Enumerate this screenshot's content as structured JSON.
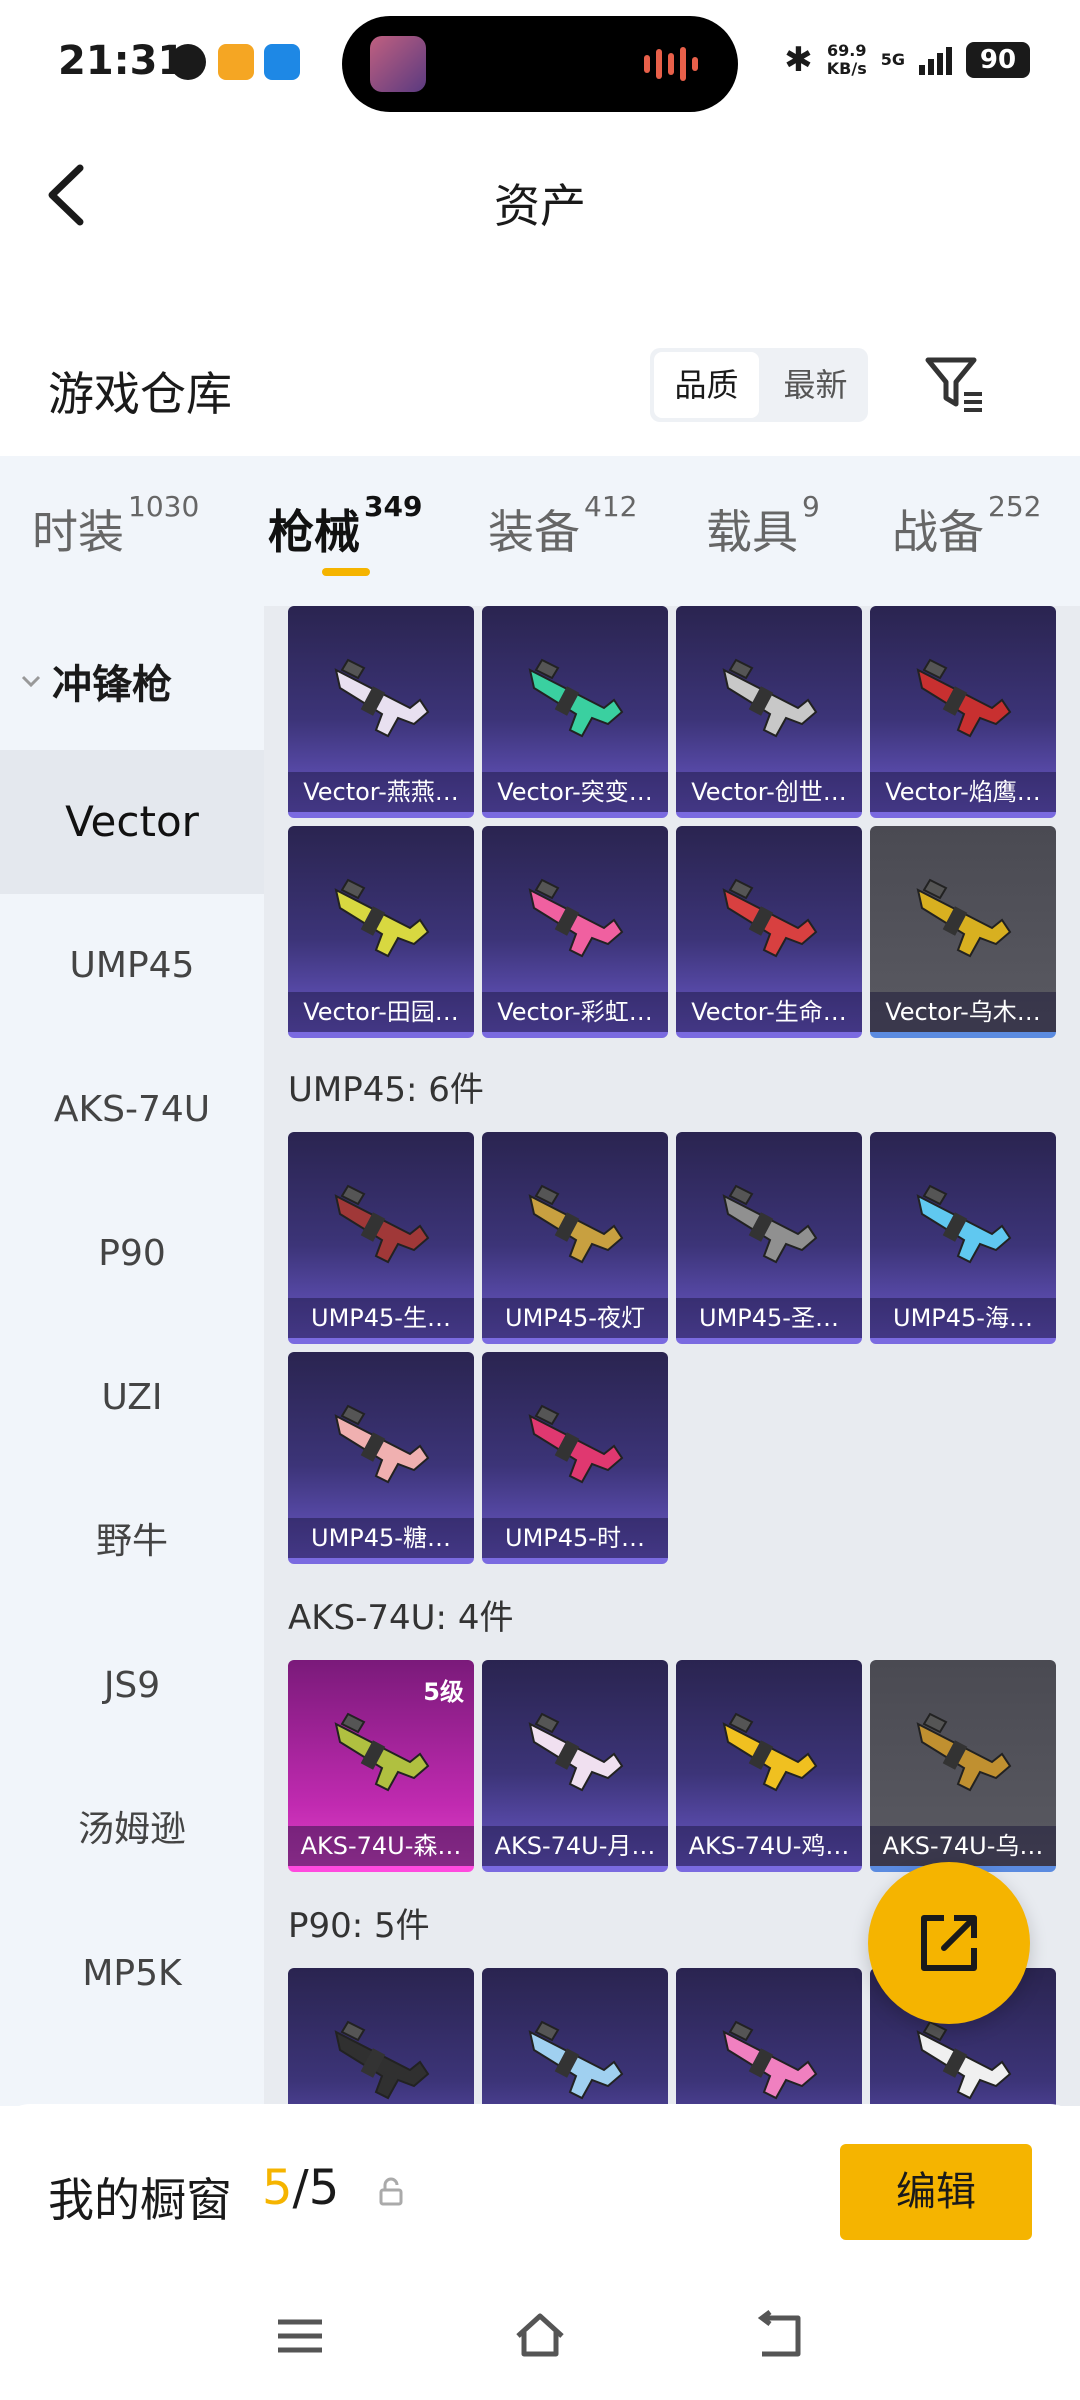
{
  "status_bar": {
    "time": "21:31",
    "speed_value": "69.9",
    "speed_unit": "KB/s",
    "network": "5G",
    "battery": "90"
  },
  "header": {
    "title": "资产"
  },
  "warehouse": {
    "title": "游戏仓库",
    "sort_options": [
      "品质",
      "最新"
    ],
    "active_sort": "品质"
  },
  "tabs": [
    {
      "label": "时装",
      "count": "1030"
    },
    {
      "label": "枪械",
      "count": "349"
    },
    {
      "label": "装备",
      "count": "412"
    },
    {
      "label": "载具",
      "count": "9"
    },
    {
      "label": "战备",
      "count": "252"
    }
  ],
  "sidebar": {
    "group": "冲锋枪",
    "items": [
      "Vector",
      "UMP45",
      "AKS-74U",
      "P90",
      "UZI",
      "野牛",
      "JS9",
      "汤姆逊",
      "MP5K"
    ],
    "active": "Vector"
  },
  "sections": [
    {
      "title": "",
      "items": [
        {
          "label": "Vector-燕燕…",
          "color": "#e8e0f0"
        },
        {
          "label": "Vector-突变…",
          "color": "#3ad0a0"
        },
        {
          "label": "Vector-创世…",
          "color": "#c8c8c8"
        },
        {
          "label": "Vector-焰鹰…",
          "color": "#c83030"
        },
        {
          "label": "Vector-田园…",
          "color": "#d8d840"
        },
        {
          "label": "Vector-彩虹…",
          "color": "#f060a0"
        },
        {
          "label": "Vector-生命…",
          "color": "#d84040"
        },
        {
          "label": "Vector-乌木…",
          "color": "#d8b020"
        }
      ]
    },
    {
      "title": "UMP45: 6件",
      "items": [
        {
          "label": "UMP45-生…",
          "color": "#a03838"
        },
        {
          "label": "UMP45-夜灯",
          "color": "#c8a040"
        },
        {
          "label": "UMP45-圣…",
          "color": "#909090"
        },
        {
          "label": "UMP45-海…",
          "color": "#60c8f0"
        },
        {
          "label": "UMP45-糖…",
          "color": "#f0b0b0"
        },
        {
          "label": "UMP45-时…",
          "color": "#e03870"
        }
      ]
    },
    {
      "title": "AKS-74U: 4件",
      "items": [
        {
          "label": "AKS-74U-森…",
          "color": "#b0c040",
          "level": "5级"
        },
        {
          "label": "AKS-74U-月…",
          "color": "#f0e0f0"
        },
        {
          "label": "AKS-74U-鸡…",
          "color": "#f0c020"
        },
        {
          "label": "AKS-74U-乌…",
          "color": "#c09030"
        }
      ]
    },
    {
      "title": "P90: 5件",
      "items": [
        {
          "label": "",
          "color": "#303030"
        },
        {
          "label": "",
          "color": "#a0d0f0"
        },
        {
          "label": "",
          "color": "#f080c0"
        },
        {
          "label": "",
          "color": "#f0f0f0"
        }
      ]
    }
  ],
  "bottom": {
    "showcase_label": "我的橱窗",
    "current": "5",
    "separator": "/",
    "total": "5",
    "edit_label": "编辑"
  },
  "colors": {
    "accent": "#f5b400",
    "tab_bg": "#f1f5fa"
  }
}
